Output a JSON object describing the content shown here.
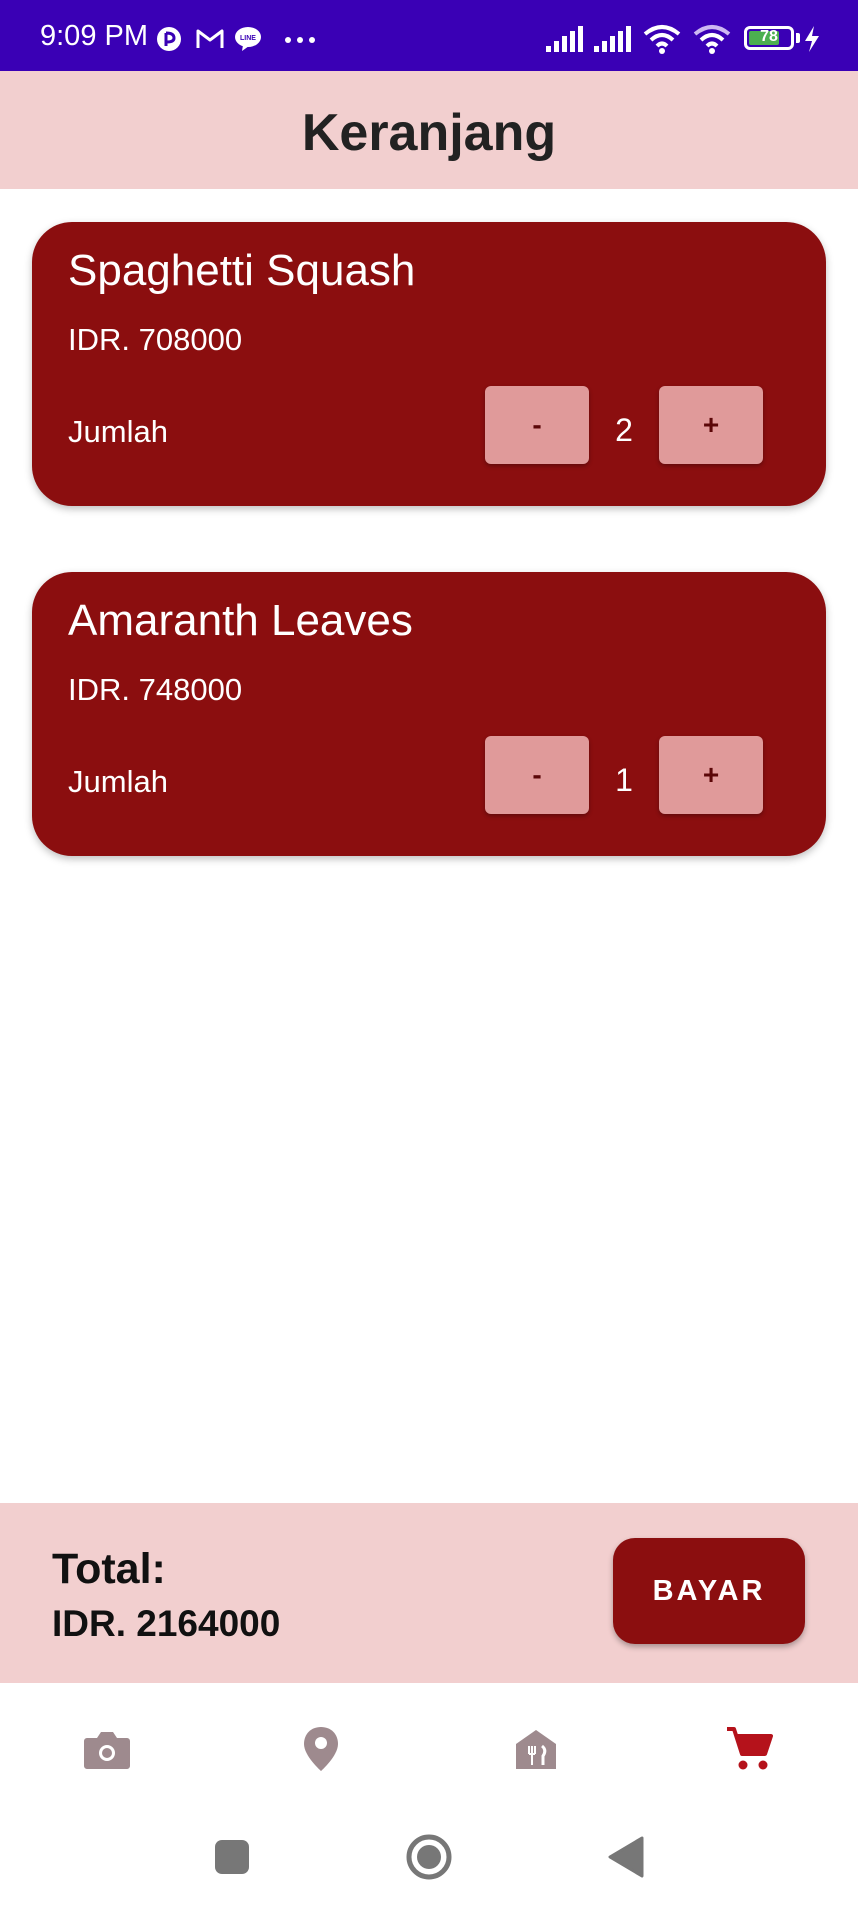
{
  "status_bar": {
    "time": "9:09 PM",
    "battery_level": "78",
    "battery_fraction": 0.78,
    "notification_icons": [
      "pinterest-like-icon",
      "gmail-icon",
      "line-icon",
      "more-dots-icon"
    ],
    "system_icons": [
      "signal-icon",
      "signal-icon",
      "wifi-icon",
      "wifi-icon",
      "battery-icon",
      "charging-icon"
    ]
  },
  "header": {
    "title": "Keranjang"
  },
  "cart": {
    "items": [
      {
        "name": "Spaghetti Squash",
        "price": "IDR. 708000",
        "qty_label": "Jumlah",
        "quantity": "2",
        "minus_label": "-",
        "plus_label": "+"
      },
      {
        "name": "Amaranth Leaves",
        "price": "IDR. 748000",
        "qty_label": "Jumlah",
        "quantity": "1",
        "minus_label": "-",
        "plus_label": "+"
      }
    ]
  },
  "footer": {
    "total_label": "Total:",
    "total_value": "IDR. 2164000",
    "pay_label": "BAYAR"
  },
  "bottom_nav": {
    "items": [
      {
        "icon": "camera-icon",
        "active": false
      },
      {
        "icon": "location-pin-icon",
        "active": false
      },
      {
        "icon": "restaurant-icon",
        "active": false
      },
      {
        "icon": "cart-icon",
        "active": true
      }
    ]
  },
  "colors": {
    "status_bar": "#3a00b5",
    "header_bg": "#f2cfcf",
    "card_bg": "#8b0e0f",
    "qty_button": "#e09a9a",
    "nav_inactive": "#9e8a8e",
    "nav_active": "#b5121b"
  }
}
